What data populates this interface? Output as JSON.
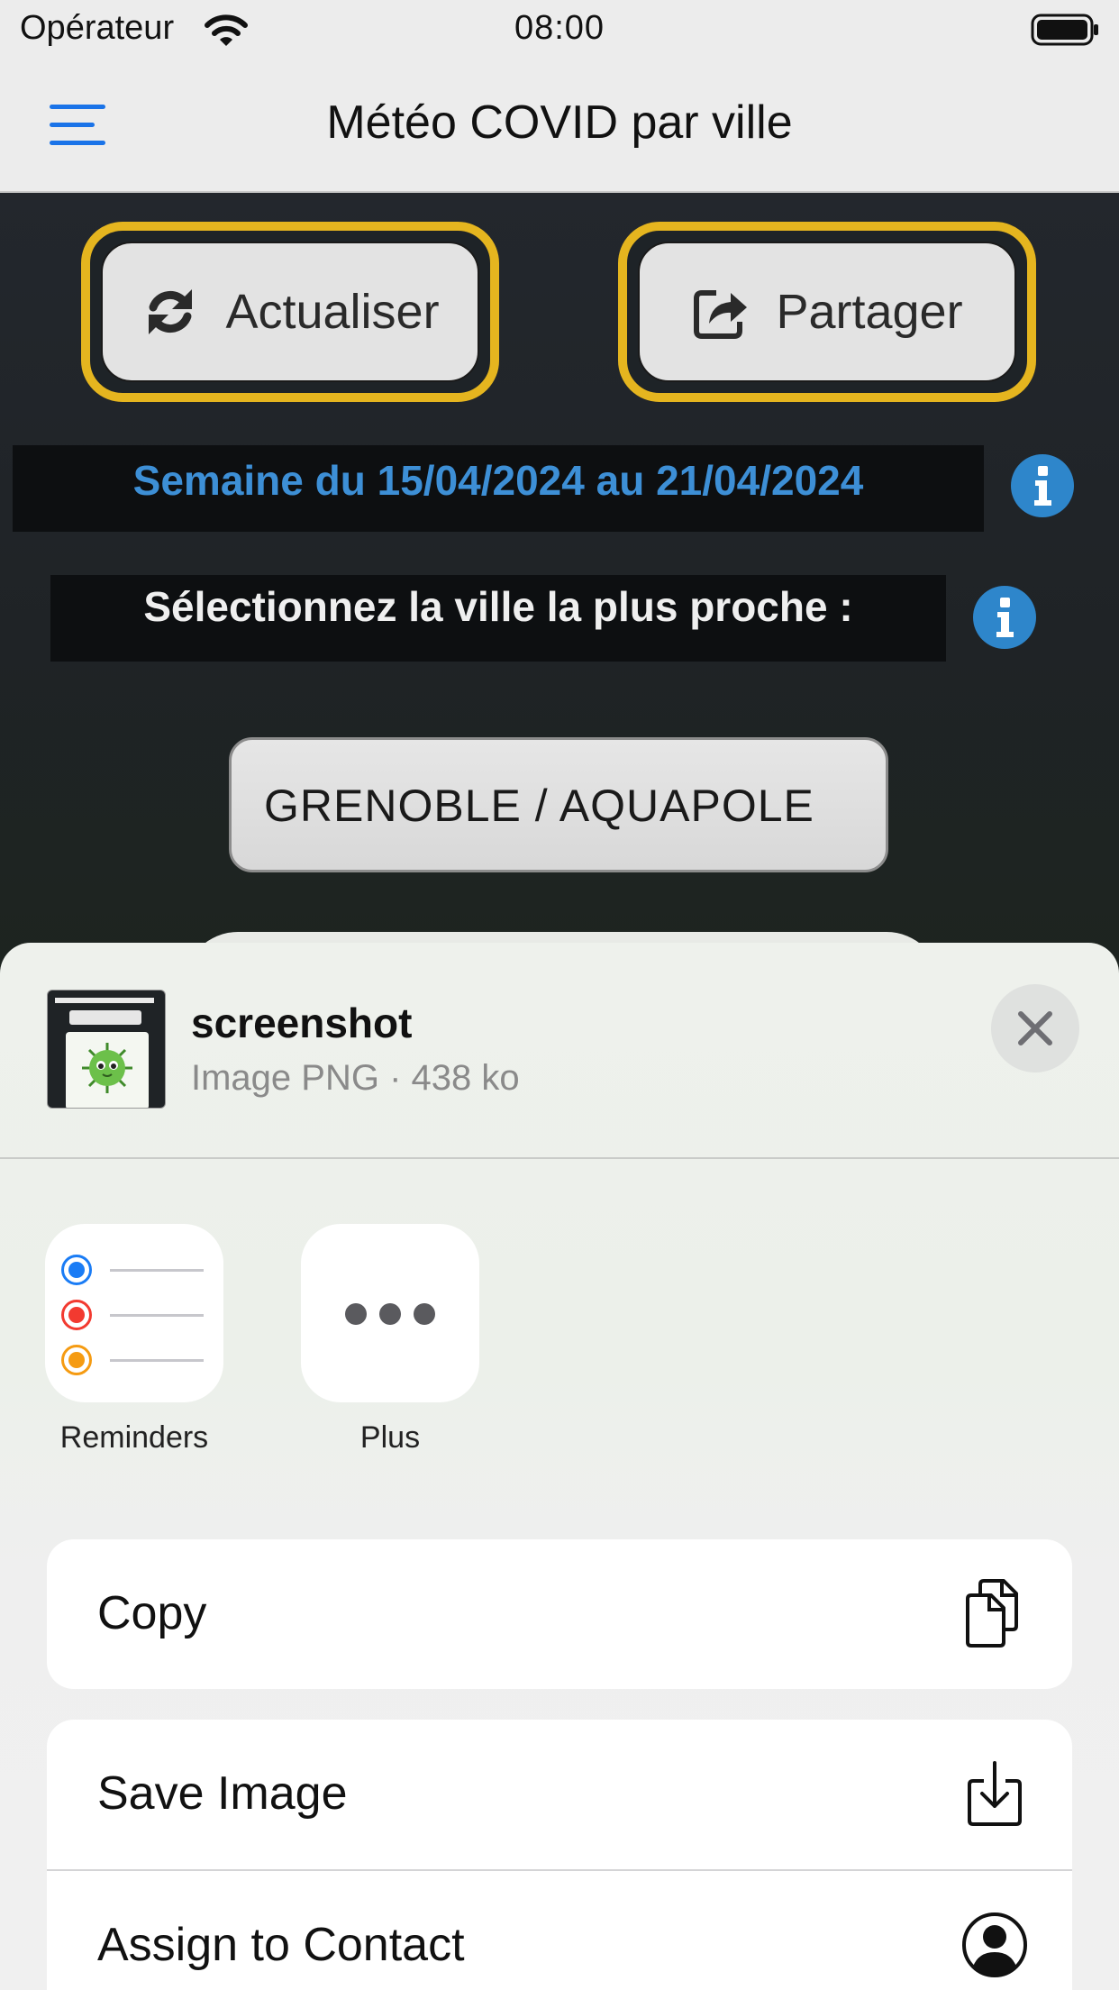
{
  "status_bar": {
    "carrier": "Opérateur",
    "time": "08:00",
    "wifi_icon": "wifi-icon",
    "battery_icon": "battery-icon"
  },
  "nav": {
    "title": "Météo COVID par ville",
    "menu_icon": "hamburger-menu-icon"
  },
  "toolbar": {
    "refresh_label": "Actualiser",
    "refresh_icon": "refresh-icon",
    "share_label": "Partager",
    "share_icon": "share-icon",
    "highlight_color": "#e5b51f"
  },
  "week": {
    "text": "Semaine du 15/04/2024 au 21/04/2024",
    "color": "#3d8fd6",
    "info_icon": "info-icon"
  },
  "city": {
    "prompt": "Sélectionnez la ville la plus proche :",
    "selected": "GRENOBLE / AQUAPOLE",
    "info_icon": "info-icon"
  },
  "share_sheet": {
    "file_name": "screenshot",
    "file_info": "Image PNG · 438 ko",
    "close_icon": "close-icon",
    "apps": [
      {
        "label": "Reminders",
        "icon": "reminders-icon"
      },
      {
        "label": "Plus",
        "icon": "more-icon"
      }
    ],
    "actions": [
      {
        "label": "Copy",
        "icon": "copy-icon"
      },
      {
        "label": "Save Image",
        "icon": "save-image-icon"
      },
      {
        "label": "Assign to Contact",
        "icon": "contact-icon"
      }
    ]
  },
  "colors": {
    "accent_blue": "#2e86cb",
    "background": "#1e2327",
    "sheet_background": "#eef1ec"
  }
}
